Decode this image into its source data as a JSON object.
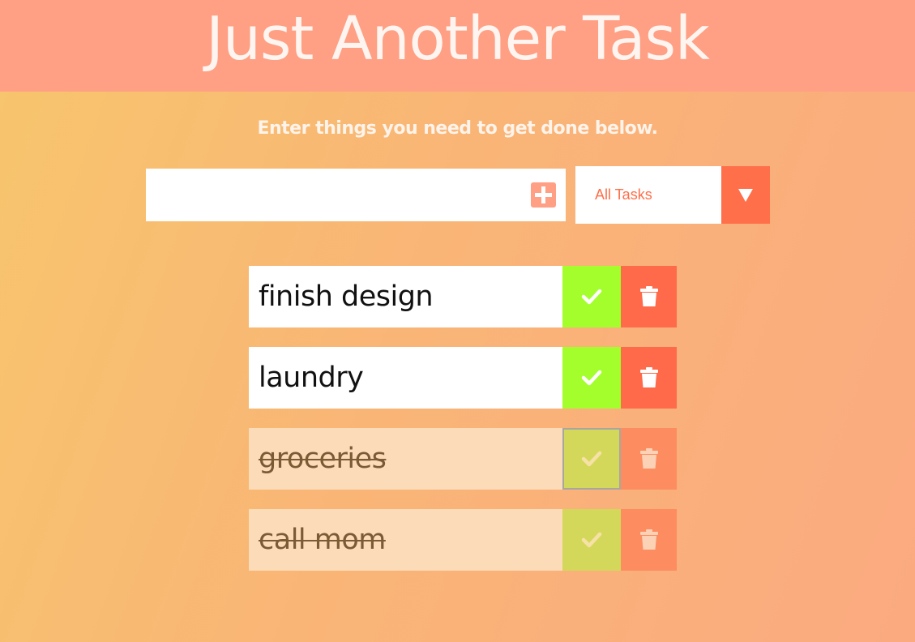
{
  "header": {
    "title": "Just Another Task"
  },
  "subtitle": "Enter things you need to get done below.",
  "input": {
    "value": "",
    "placeholder": ""
  },
  "add_button": {
    "icon": "plus-square-icon"
  },
  "filter": {
    "selected": "All Tasks",
    "icon": "caret-down-icon"
  },
  "todos": [
    {
      "text": "finish design",
      "completed": false
    },
    {
      "text": "laundry",
      "completed": false
    },
    {
      "text": "groceries",
      "completed": true
    },
    {
      "text": "call mom",
      "completed": true
    }
  ],
  "colors": {
    "header_bg": "#ff9f84",
    "accent": "#ff6f4a",
    "check_green": "#a4fe2c",
    "trash_red": "#ff6a4a"
  }
}
